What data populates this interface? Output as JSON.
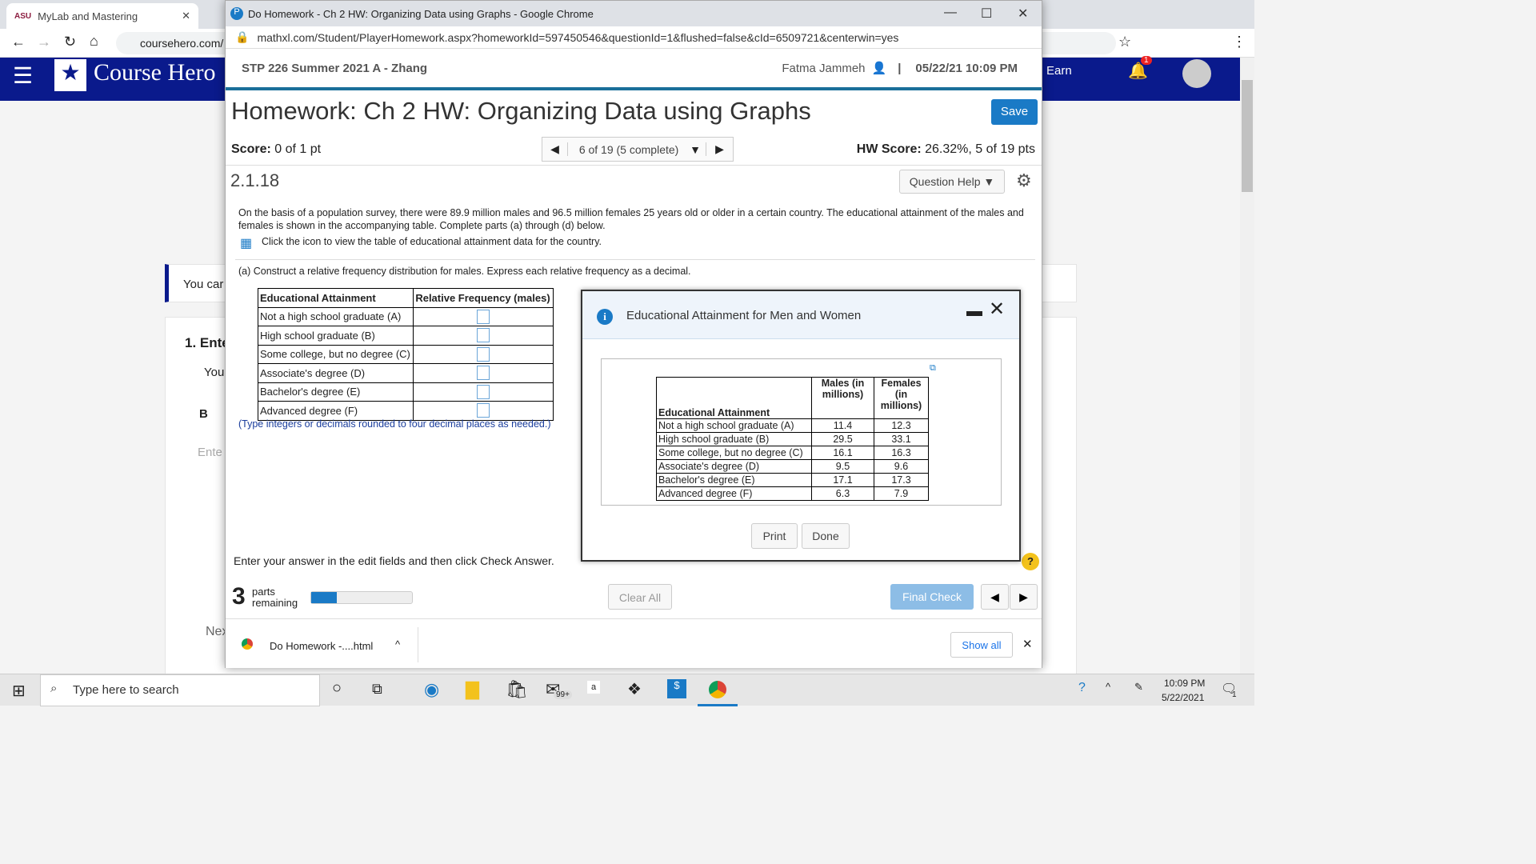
{
  "bg_browser": {
    "tab_label": "MyLab and Mastering",
    "tab_logo": "ASU",
    "url": "coursehero.com/",
    "coursehero_logo": "Course Hero",
    "earn": "Earn",
    "notif_count": "1",
    "snippets": {
      "you_can": "You car",
      "enter": "1. Ente",
      "you": "You",
      "bold": "B",
      "enter_field": "Ente",
      "next": "Nex"
    }
  },
  "popup": {
    "window_title": "Do Homework - Ch 2 HW: Organizing Data using Graphs - Google Chrome",
    "url": "mathxl.com/Student/PlayerHomework.aspx?homeworkId=597450546&questionId=1&flushed=false&cId=6509721&centerwin=yes",
    "course": "STP 226 Summer 2021 A - Zhang",
    "user": "Fatma Jammeh",
    "datetime": "05/22/21 10:09 PM",
    "hw_title": "Homework: Ch 2 HW: Organizing Data using Graphs",
    "save": "Save",
    "score_label": "Score:",
    "score": "0 of 1 pt",
    "nav": "6 of 19 (5 complete)",
    "hw_score_label": "HW Score:",
    "hw_score": "26.32%, 5 of 19 pts",
    "question_id": "2.1.18",
    "question_help": "Question Help",
    "problem": "On the basis of a population survey, there were 89.9 million males and 96.5 million females 25 years old or older in a certain country. The educational attainment of the males and females is shown in the accompanying table. Complete parts (a) through (d) below.",
    "icon_hint": "Click the icon to view the table of educational attainment data for the country.",
    "part_a": "(a) Construct a relative frequency distribution for males. Express each relative frequency as a decimal.",
    "answer_table": {
      "headers": [
        "Educational Attainment",
        "Relative Frequency (males)"
      ],
      "rows": [
        "Not a high school graduate (A)",
        "High school graduate (B)",
        "Some college, but no degree (C)",
        "Associate's degree (D)",
        "Bachelor's degree (E)",
        "Advanced degree (F)"
      ]
    },
    "hint": "(Type integers or decimals rounded to four decimal places as needed.)",
    "instruction": "Enter your answer in the edit fields and then click Check Answer.",
    "parts_count": "3",
    "parts_label1": "parts",
    "parts_label2": "remaining",
    "progress": 0.25,
    "clear_all": "Clear All",
    "final_check": "Final Check"
  },
  "dialog": {
    "title": "Educational Attainment for Men and Women",
    "headers": [
      "Educational Attainment",
      "Males (in millions)",
      "Females (in millions)"
    ],
    "rows": [
      [
        "Not a high school graduate (A)",
        "11.4",
        "12.3"
      ],
      [
        "High school graduate (B)",
        "29.5",
        "33.1"
      ],
      [
        "Some college, but no degree (C)",
        "16.1",
        "16.3"
      ],
      [
        "Associate's degree (D)",
        "9.5",
        "9.6"
      ],
      [
        "Bachelor's degree (E)",
        "17.1",
        "17.3"
      ],
      [
        "Advanced degree (F)",
        "6.3",
        "7.9"
      ]
    ],
    "print": "Print",
    "done": "Done"
  },
  "download_bar": {
    "file": "Do Homework -....html",
    "show_all": "Show all"
  },
  "taskbar": {
    "search_placeholder": "Type here to search",
    "mail_badge": "99+",
    "time": "10:09 PM",
    "date": "5/22/2021",
    "notif": "1"
  }
}
